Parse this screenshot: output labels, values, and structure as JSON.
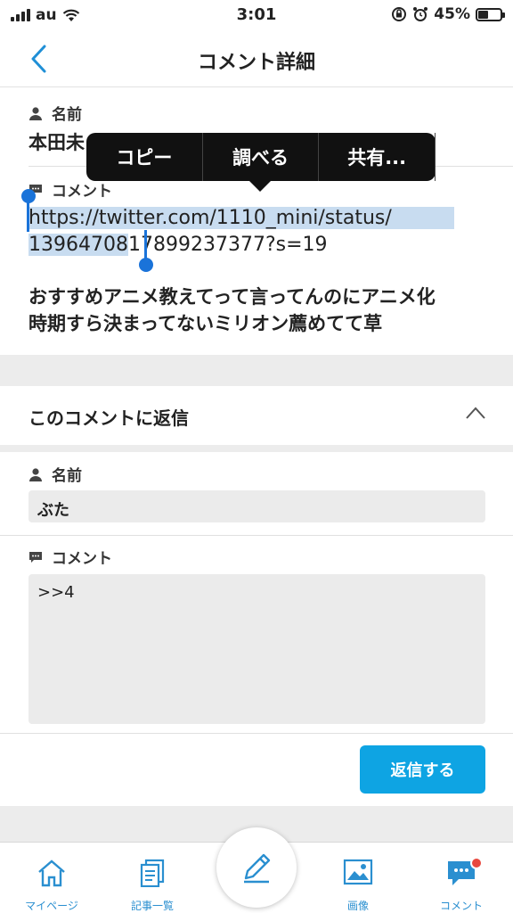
{
  "status_bar": {
    "carrier": "au",
    "time": "3:01",
    "battery": "45%"
  },
  "nav": {
    "title": "コメント詳細"
  },
  "comment": {
    "name_label": "名前",
    "name_value": "本田未",
    "comment_label": "コメント",
    "url_line1": "https://twitter.com/1110_mini/status/",
    "url_line2_selected": "13964708",
    "url_line2_rest": "17899237377?s=19",
    "body_line1": "おすすめアニメ教えてって言ってんのにアニメ化",
    "body_line2": "時期すら決まってないミリオン薦めてて草"
  },
  "edit_menu": {
    "items": [
      "コピー",
      "調べる",
      "共有..."
    ]
  },
  "reply": {
    "header": "このコメントに返信",
    "name_label": "名前",
    "name_value": "ぶた",
    "comment_label": "コメント",
    "comment_value": ">>4",
    "submit_label": "返信する"
  },
  "tabbar": {
    "items": [
      {
        "label": "マイページ",
        "icon": "home-icon"
      },
      {
        "label": "記事一覧",
        "icon": "articles-icon"
      },
      {
        "label": "画像",
        "icon": "image-icon"
      },
      {
        "label": "コメント",
        "icon": "comment-icon"
      }
    ],
    "fab_icon": "pencil-icon"
  },
  "colors": {
    "accent": "#0ea4e3",
    "tab_label": "#2a8fd0",
    "selection": "#c8dcf0",
    "badge": "#e8483e"
  }
}
